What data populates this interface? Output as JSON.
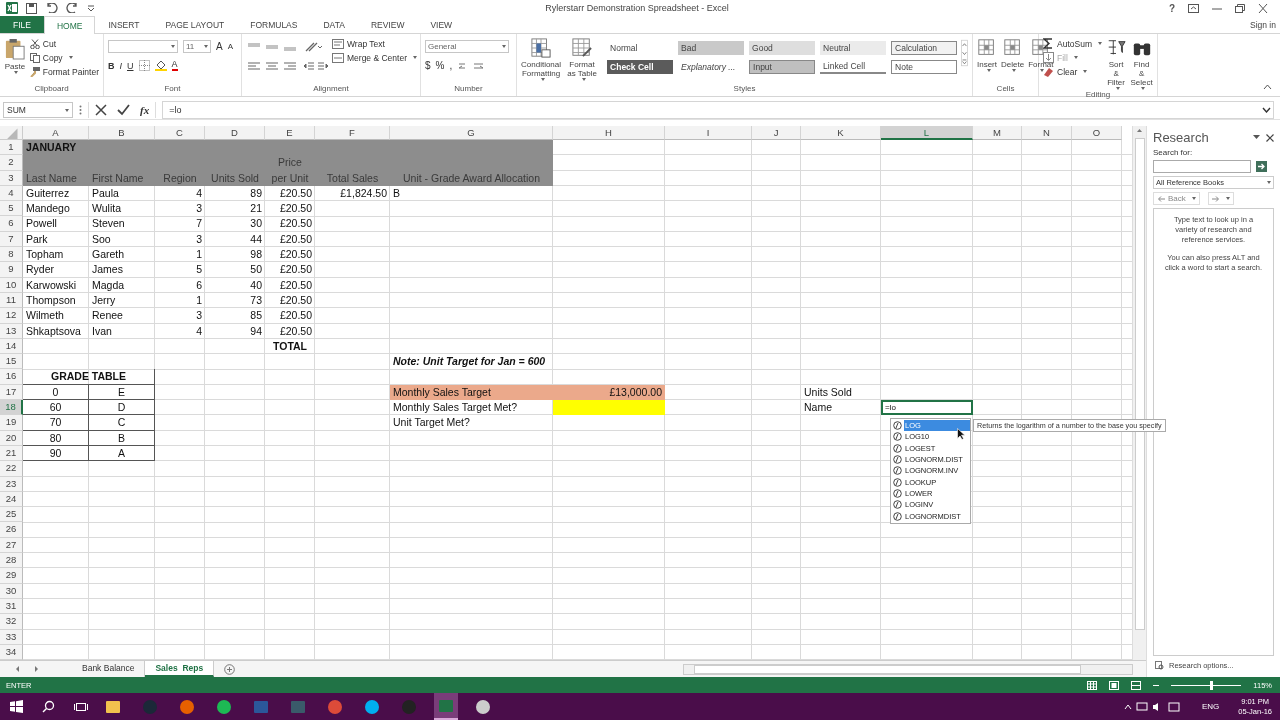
{
  "window": {
    "title": "Rylerstarr Demonstration Spreadsheet - Excel",
    "help": "?",
    "sign_in": "Sign in"
  },
  "tabs": [
    {
      "label": "FILE",
      "kind": "file",
      "selected": false
    },
    {
      "label": "HOME",
      "kind": "tab",
      "selected": true
    },
    {
      "label": "INSERT",
      "kind": "tab",
      "selected": false
    },
    {
      "label": "PAGE LAYOUT",
      "kind": "tab",
      "selected": false
    },
    {
      "label": "FORMULAS",
      "kind": "tab",
      "selected": false
    },
    {
      "label": "DATA",
      "kind": "tab",
      "selected": false
    },
    {
      "label": "REVIEW",
      "kind": "tab",
      "selected": false
    },
    {
      "label": "VIEW",
      "kind": "tab",
      "selected": false
    }
  ],
  "ribbon": {
    "groups": [
      {
        "kind": "clipboard",
        "name": "Clipboard",
        "big": "Paste",
        "items": [
          "Cut",
          "Copy",
          "Format Painter"
        ]
      },
      {
        "kind": "font",
        "name": "Font",
        "size": "11",
        "grow": "A",
        "shrink": "A",
        "styles": [
          "B",
          "I",
          "U"
        ],
        "color_button": "A"
      },
      {
        "kind": "alignment",
        "name": "Alignment",
        "items": [
          "Wrap Text",
          "Merge & Center"
        ]
      },
      {
        "kind": "number",
        "name": "Number",
        "format": "General",
        "symbols": [
          "$",
          "%",
          ","
        ]
      },
      {
        "kind": "styles",
        "name": "Styles",
        "big": [
          "Conditional Formatting",
          "Format as Table"
        ],
        "cell_styles": [
          {
            "label": "Normal",
            "kind": "plain",
            "color": "#ffffff"
          },
          {
            "label": "Bad",
            "kind": "plain",
            "color": "#c9c9c9"
          },
          {
            "label": "Good",
            "kind": "plain",
            "color": "#dedede"
          },
          {
            "label": "Neutral",
            "kind": "plain",
            "color": "#ebebeb"
          },
          {
            "label": "Calculation",
            "kind": "boxed",
            "color": "#f2f2f2"
          },
          {
            "label": "Check Cell",
            "kind": "dark",
            "color": "#5b5b5b"
          },
          {
            "label": "Explanatory ...",
            "kind": "italic",
            "color": "#ffffff"
          },
          {
            "label": "Input",
            "kind": "boxed",
            "color": "#bfbfbf"
          },
          {
            "label": "Linked Cell",
            "kind": "linked",
            "color": "#ffffff"
          },
          {
            "label": "Note",
            "kind": "boxed",
            "color": "#ffffff"
          }
        ]
      },
      {
        "kind": "cells",
        "name": "Cells",
        "big": [
          "Insert",
          "Delete",
          "Format"
        ]
      },
      {
        "kind": "editing",
        "name": "Editing",
        "items": [
          {
            "label": "AutoSum",
            "disabled": false
          },
          {
            "label": "Fill",
            "disabled": true
          },
          {
            "label": "Clear",
            "disabled": false
          }
        ],
        "big": [
          "Sort & Filter",
          "Find & Select"
        ]
      }
    ]
  },
  "formula_bar": {
    "name_box": "SUM",
    "function_button": "fx",
    "formula": "=lo"
  },
  "sheet": {
    "columns": [
      {
        "label": "A",
        "selected": false
      },
      {
        "label": "B",
        "selected": false
      },
      {
        "label": "C",
        "selected": false
      },
      {
        "label": "D",
        "selected": false
      },
      {
        "label": "E",
        "selected": false
      },
      {
        "label": "F",
        "selected": false
      },
      {
        "label": "G",
        "selected": false
      },
      {
        "label": "H",
        "selected": false
      },
      {
        "label": "I",
        "selected": false
      },
      {
        "label": "J",
        "selected": false
      },
      {
        "label": "K",
        "selected": false
      },
      {
        "label": "L",
        "selected": true
      },
      {
        "label": "M",
        "selected": false
      },
      {
        "label": "N",
        "selected": false
      },
      {
        "label": "O",
        "selected": false
      }
    ],
    "rows": [
      {
        "label": "1",
        "selected": false
      },
      {
        "label": "2",
        "selected": false
      },
      {
        "label": "3",
        "selected": false
      },
      {
        "label": "4",
        "selected": false
      },
      {
        "label": "5",
        "selected": false
      },
      {
        "label": "6",
        "selected": false
      },
      {
        "label": "7",
        "selected": false
      },
      {
        "label": "8",
        "selected": false
      },
      {
        "label": "9",
        "selected": false
      },
      {
        "label": "10",
        "selected": false
      },
      {
        "label": "11",
        "selected": false
      },
      {
        "label": "12",
        "selected": false
      },
      {
        "label": "13",
        "selected": false
      },
      {
        "label": "14",
        "selected": false
      },
      {
        "label": "15",
        "selected": false
      },
      {
        "label": "16",
        "selected": false
      },
      {
        "label": "17",
        "selected": false
      },
      {
        "label": "18",
        "selected": true
      },
      {
        "label": "19",
        "selected": false
      },
      {
        "label": "20",
        "selected": false
      },
      {
        "label": "21",
        "selected": false
      },
      {
        "label": "22",
        "selected": false
      },
      {
        "label": "23",
        "selected": false
      },
      {
        "label": "24",
        "selected": false
      },
      {
        "label": "25",
        "selected": false
      },
      {
        "label": "26",
        "selected": false
      },
      {
        "label": "27",
        "selected": false
      },
      {
        "label": "28",
        "selected": false
      },
      {
        "label": "29",
        "selected": false
      },
      {
        "label": "30",
        "selected": false
      },
      {
        "label": "31",
        "selected": false
      },
      {
        "label": "32",
        "selected": false
      },
      {
        "label": "33",
        "selected": false
      },
      {
        "label": "34",
        "selected": false
      }
    ]
  },
  "sales_table": {
    "title": "JANUARY",
    "headers": [
      {
        "text": "Last Name"
      },
      {
        "text": "First Name"
      },
      {
        "text": "Region"
      },
      {
        "text": "Units Sold"
      },
      {
        "text": "per Unit",
        "above": "Price"
      },
      {
        "text": "Total Sales"
      },
      {
        "text": "Unit - Grade Award Allocation"
      }
    ],
    "records": [
      {
        "last": "Guiterrez",
        "first": "Paula",
        "region": "4",
        "units": "89",
        "price": "£20.50",
        "total": "£1,824.50",
        "grade": "B"
      },
      {
        "last": "Mandego",
        "first": "Wulita",
        "region": "3",
        "units": "21",
        "price": "£20.50"
      },
      {
        "last": "Powell",
        "first": "Steven",
        "region": "7",
        "units": "30",
        "price": "£20.50"
      },
      {
        "last": "Park",
        "first": "Soo",
        "region": "3",
        "units": "44",
        "price": "£20.50"
      },
      {
        "last": "Topham",
        "first": "Gareth",
        "region": "1",
        "units": "98",
        "price": "£20.50"
      },
      {
        "last": "Ryder",
        "first": "James",
        "region": "5",
        "units": "50",
        "price": "£20.50"
      },
      {
        "last": "Karwowski",
        "first": "Magda",
        "region": "6",
        "units": "40",
        "price": "£20.50"
      },
      {
        "last": "Thompson",
        "first": "Jerry",
        "region": "1",
        "units": "73",
        "price": "£20.50"
      },
      {
        "last": "Wilmeth",
        "first": "Renee",
        "region": "3",
        "units": "85",
        "price": "£20.50"
      },
      {
        "last": "Shkaptsova",
        "first": "Ivan",
        "region": "4",
        "units": "94",
        "price": "£20.50"
      }
    ],
    "total_label": "TOTAL"
  },
  "note": "Note: Unit Target for Jan = 600",
  "grade_table": {
    "title": "GRADE TABLE",
    "rows": [
      {
        "score": "0",
        "grade": "E"
      },
      {
        "score": "60",
        "grade": "D"
      },
      {
        "score": "70",
        "grade": "C"
      },
      {
        "score": "80",
        "grade": "B"
      },
      {
        "score": "90",
        "grade": "A"
      }
    ]
  },
  "targets": [
    {
      "label": "Monthly Sales Target",
      "value": "£13,000.00",
      "kind": "target"
    },
    {
      "label": "Monthly Sales Target Met?",
      "kind": "highlight"
    },
    {
      "label": "Unit Target Met?",
      "kind": "plain"
    }
  ],
  "side_labels": [
    "Units Sold",
    "Name"
  ],
  "active_cell": "=lo",
  "autocomplete": {
    "items": [
      {
        "name": "LOG",
        "selected": true
      },
      {
        "name": "LOG10",
        "selected": false
      },
      {
        "name": "LOGEST",
        "selected": false
      },
      {
        "name": "LOGNORM.DIST",
        "selected": false
      },
      {
        "name": "LOGNORM.INV",
        "selected": false
      },
      {
        "name": "LOOKUP",
        "selected": false
      },
      {
        "name": "LOWER",
        "selected": false
      },
      {
        "name": "LOGINV",
        "selected": false
      },
      {
        "name": "LOGNORMDIST",
        "selected": false
      }
    ],
    "tooltip": "Returns the logarithm of a number to the base you specify"
  },
  "research": {
    "title": "Research",
    "search_label": "Search for:",
    "source": "All Reference Books",
    "back": "Back",
    "info": [
      "Type text to look up in a variety of research and reference services.",
      "You can also press ALT and click a word to start a search."
    ],
    "options": "Research options..."
  },
  "sheet_tabs": [
    {
      "label": "Bank Balance",
      "selected": false
    },
    {
      "label": "Sales  Reps",
      "selected": true
    }
  ],
  "status_bar": {
    "mode": "ENTER",
    "zoom": {
      "level": 0.55,
      "reading": "115%"
    }
  },
  "taskbar": {
    "language": "ENG",
    "time": "9:01 PM",
    "date": "05-Jan-16"
  }
}
